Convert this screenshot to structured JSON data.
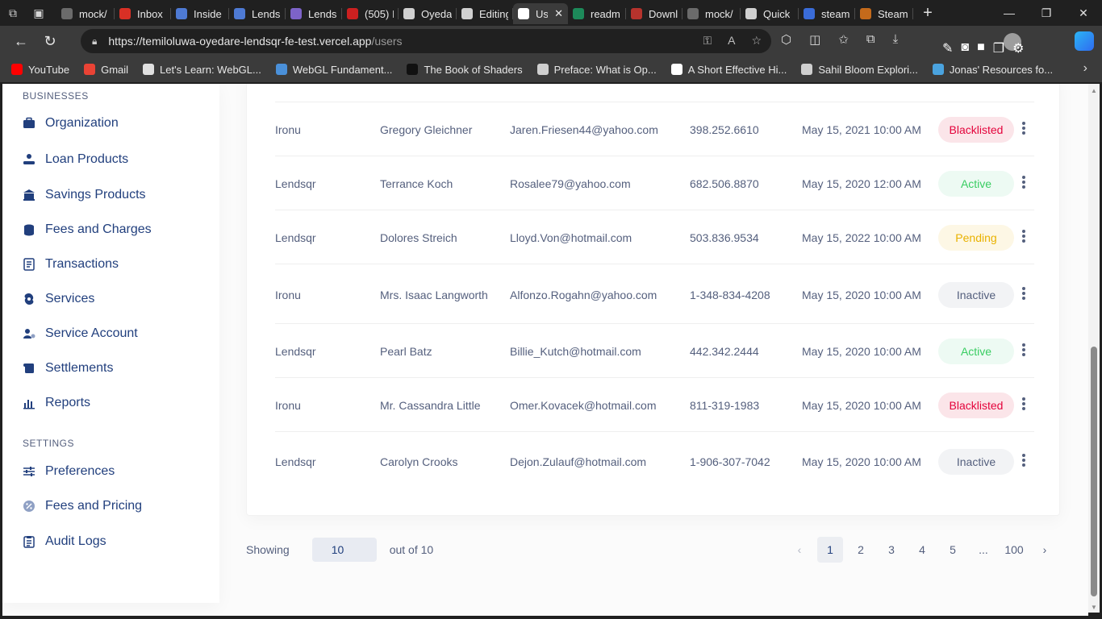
{
  "browser": {
    "tabs": [
      {
        "label": "mock/",
        "color": "#6b6b6b"
      },
      {
        "label": "Inbox",
        "color": "#d93025"
      },
      {
        "label": "Inside",
        "color": "#4e7ad4"
      },
      {
        "label": "Lends",
        "color": "#4e7ad4"
      },
      {
        "label": "Lends",
        "color": "#7d63c8"
      },
      {
        "label": "(505) I",
        "color": "#cc2020"
      },
      {
        "label": "Oyeda",
        "color": "#d0d0d0"
      },
      {
        "label": "Editing",
        "color": "#d0d0d0"
      },
      {
        "label": "Us",
        "color": "#ffffff",
        "active": true
      },
      {
        "label": "readm",
        "color": "#1d8a5a"
      },
      {
        "label": "Downl",
        "color": "#b7332d"
      },
      {
        "label": "mock/",
        "color": "#6b6b6b"
      },
      {
        "label": "Quick",
        "color": "#d0d0d0"
      },
      {
        "label": "steam",
        "color": "#3a6cd8"
      },
      {
        "label": "Steam",
        "color": "#c46a1b"
      }
    ],
    "url_host": "https://temiloluwa-oyedare-lendsqr-fe-test.vercel.app",
    "url_path": "/users",
    "bookmarks": [
      {
        "label": "YouTube",
        "color": "#ff0000"
      },
      {
        "label": "Gmail",
        "color": "#ea4335"
      },
      {
        "label": "Let's Learn: WebGL...",
        "color": "#e0e0e0"
      },
      {
        "label": "WebGL Fundament...",
        "color": "#4a90d9"
      },
      {
        "label": "The Book of Shaders",
        "color": "#111111"
      },
      {
        "label": "Preface: What is Op...",
        "color": "#cfcfcf"
      },
      {
        "label": "A Short Effective Hi...",
        "color": "#ffffff"
      },
      {
        "label": "Sahil Bloom Explori...",
        "color": "#cfcfcf"
      },
      {
        "label": "Jonas' Resources fo...",
        "color": "#4aa3df"
      }
    ]
  },
  "sidebar": {
    "businesses_heading": "BUSINESSES",
    "settings_heading": "SETTINGS",
    "businesses": [
      {
        "label": "Organization",
        "icon": "briefcase-icon"
      },
      {
        "label": "Loan Products",
        "icon": "loan-request-icon"
      },
      {
        "label": "Savings Products",
        "icon": "bank-icon"
      },
      {
        "label": "Fees and Charges",
        "icon": "coins-icon"
      },
      {
        "label": "Transactions",
        "icon": "transactions-icon"
      },
      {
        "label": "Services",
        "icon": "galaxy-icon"
      },
      {
        "label": "Service Account",
        "icon": "user-cog-icon"
      },
      {
        "label": "Settlements",
        "icon": "scroll-icon"
      },
      {
        "label": "Reports",
        "icon": "chart-bar-icon"
      }
    ],
    "settings": [
      {
        "label": "Preferences",
        "icon": "sliders-icon"
      },
      {
        "label": "Fees and Pricing",
        "icon": "badge-percent-icon"
      },
      {
        "label": "Audit Logs",
        "icon": "clipboard-list-icon"
      }
    ]
  },
  "table": {
    "rows": [
      {
        "org": "Ironu",
        "username": "Gregory Gleichner",
        "email": "Jaren.Friesen44@yahoo.com",
        "phone": "398.252.6610",
        "date": "May 15, 2021 10:00 AM",
        "status": "Blacklisted"
      },
      {
        "org": "Lendsqr",
        "username": "Terrance Koch",
        "email": "Rosalee79@yahoo.com",
        "phone": "682.506.8870",
        "date": "May 15, 2020 12:00 AM",
        "status": "Active"
      },
      {
        "org": "Lendsqr",
        "username": "Dolores Streich",
        "email": "Lloyd.Von@hotmail.com",
        "phone": "503.836.9534",
        "date": "May 15, 2022 10:00 AM",
        "status": "Pending"
      },
      {
        "org": "Ironu",
        "username": "Mrs. Isaac Langworth",
        "email": "Alfonzo.Rogahn@yahoo.com",
        "phone": "1-348-834-4208",
        "date": "May 15, 2020 10:00 AM",
        "status": "Inactive"
      },
      {
        "org": "Lendsqr",
        "username": "Pearl Batz",
        "email": "Billie_Kutch@hotmail.com",
        "phone": "442.342.2444",
        "date": "May 15, 2020 10:00 AM",
        "status": "Active"
      },
      {
        "org": "Ironu",
        "username": "Mr. Cassandra Little",
        "email": "Omer.Kovacek@hotmail.com",
        "phone": "811-319-1983",
        "date": "May 15, 2020 10:00 AM",
        "status": "Blacklisted"
      },
      {
        "org": "Lendsqr",
        "username": "Carolyn Crooks",
        "email": "Dejon.Zulauf@hotmail.com",
        "phone": "1-906-307-7042",
        "date": "May 15, 2020 10:00 AM",
        "status": "Inactive"
      }
    ]
  },
  "pagination": {
    "showing_label": "Showing",
    "page_size": "10",
    "out_of_label": "out of 10",
    "pages": [
      "1",
      "2",
      "3",
      "4",
      "5",
      "...",
      "100"
    ],
    "current_page": "1"
  },
  "colors": {
    "primary_text": "#213f7d",
    "secondary_text": "#545f7d",
    "blacklisted": "#e4033b",
    "active": "#39cd62",
    "pending": "#e9b200"
  }
}
